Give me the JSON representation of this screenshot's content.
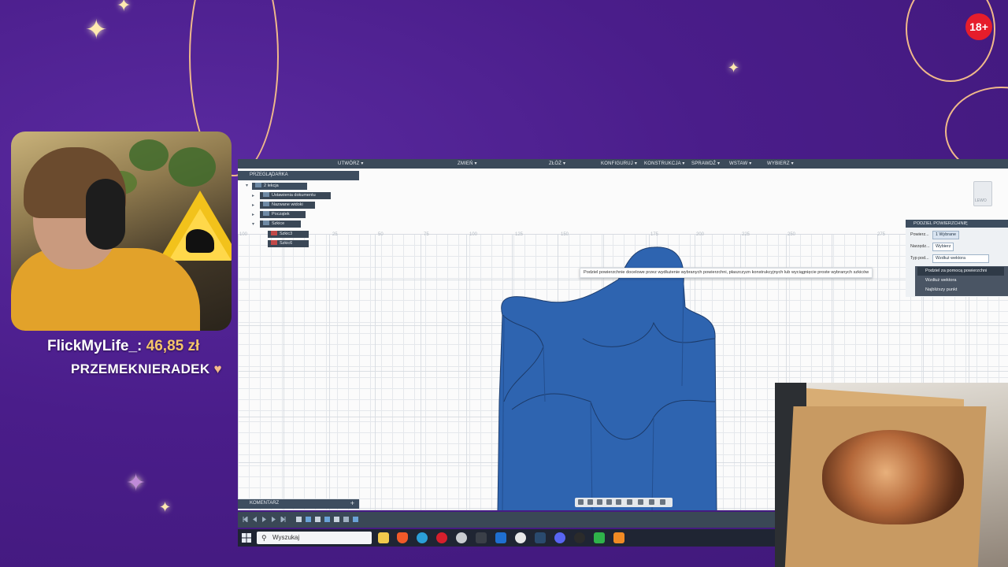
{
  "overlay": {
    "alert_donation_user": "FlickMyLife_:",
    "alert_donation_amount": "46,85 zł",
    "alert_sub_user": "PRZEMEKNIERADEK",
    "alert_sub_heart": "♥",
    "age_badge": "18+",
    "colors": {
      "background": "#4b1f8c",
      "accent": "#f0b98a",
      "badge": "#e61d2b"
    }
  },
  "fusion": {
    "menu": [
      "UTWÓRZ ▾",
      "ZMIEŃ ▾",
      "ZŁÓŻ ▾",
      "KONFIGURUJ ▾",
      "KONSTRUKCJA ▾",
      "SPRAWDŹ ▾",
      "WSTAW ▾",
      "WYBIERZ ▾"
    ],
    "browser": {
      "title": "PRZEGLĄDARKA",
      "root": "2 lekcja",
      "items": [
        "Ustawienia dokumentu",
        "Nazwane widoki",
        "Początek",
        "Szkice",
        "Szkic3",
        "Szkic6"
      ]
    },
    "ruler_numbers": [
      "100",
      "25",
      "50",
      "75",
      "100",
      "125",
      "150",
      "175",
      "200",
      "225",
      "250",
      "275"
    ],
    "view_cube_label": "LEWO",
    "tooltip": "Podziel powierzchnie docelowe przez wydłużenie wybranych powierzchni, płaszczyzn konstrukcyjnych lub wyciągnięcie proste wybranych szkiców",
    "dialog": {
      "title": "PODZIEL POWIERZCHNIĘ",
      "row1_label": "Powierz...",
      "row1_value": "1 Wybrane",
      "row2_label": "Narzędz...",
      "row2_value": "Wybierz",
      "row3_label": "Typ pod...",
      "row3_value": "Wzdłuż wektora",
      "options": [
        "Podziel za pomocą powierzchni",
        "Wzdłuż wektora",
        "Najbliższy punkt"
      ]
    },
    "comment_panel": "KOMENTARZ",
    "model_color": "#2e64b0"
  },
  "taskbar": {
    "search_placeholder": "Wyszukaj"
  }
}
